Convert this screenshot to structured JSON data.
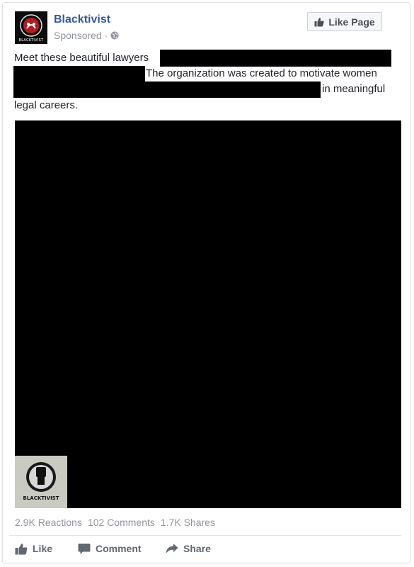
{
  "post": {
    "page_name": "Blacktivist",
    "sponsored_label": "Sponsored ·",
    "logo_text": "BLACKTIVIST",
    "like_page_label": "Like Page",
    "text_line1": "Meet these beautiful lawyers",
    "text_line2": "The organization was created to motivate women",
    "text_line3": "in meaningful",
    "text_line4": "legal careers."
  },
  "image": {
    "watermark_text": "BLACKTIVIST"
  },
  "stats": {
    "reactions": "2.9K Reactions",
    "comments": "102 Comments",
    "shares": "1.7K Shares"
  },
  "actions": {
    "like": "Like",
    "comment": "Comment",
    "share": "Share"
  },
  "colors": {
    "page_name": "#365899",
    "muted": "#90949c",
    "action": "#606770"
  },
  "icons": {
    "globe": "globe-icon",
    "thumbs_up": "thumbs-up-icon",
    "comment": "comment-icon",
    "share": "share-icon",
    "fist": "raised-fist-icon"
  }
}
